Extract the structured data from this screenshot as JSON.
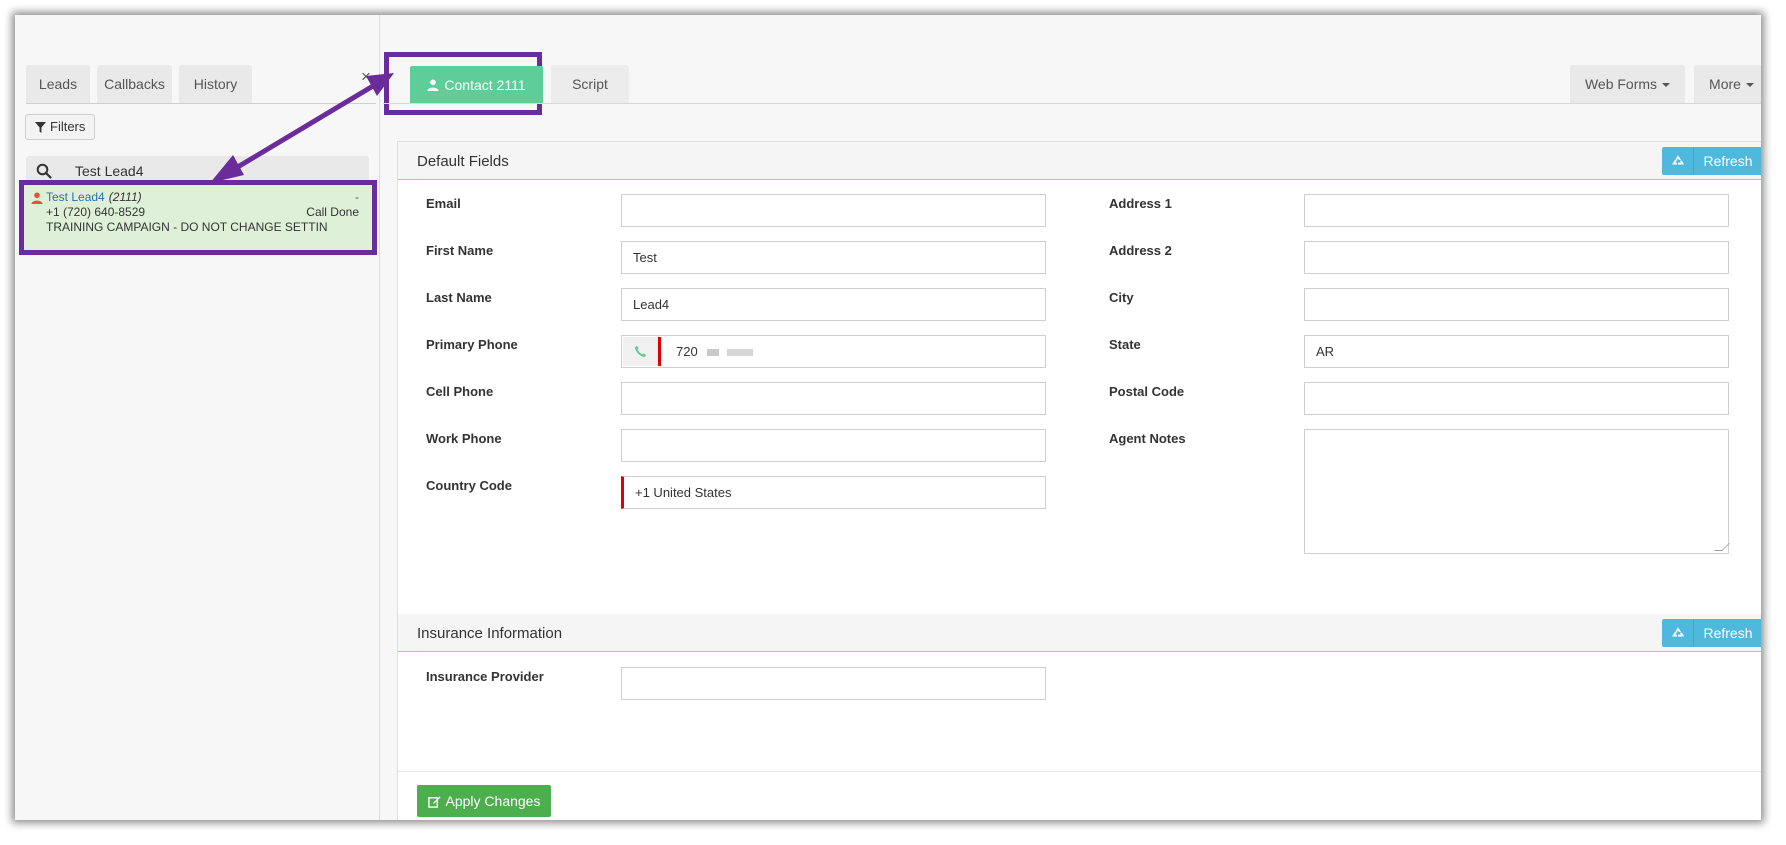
{
  "left_tabs": {
    "leads": "Leads",
    "callbacks": "Callbacks",
    "history": "History"
  },
  "filters": {
    "label": "Filters"
  },
  "search": {
    "value": "Test Lead4"
  },
  "lead": {
    "name": "Test Lead4",
    "id": "(2111)",
    "dash": "-",
    "phone": "+1 (720) 640-8529",
    "status": "Call Done",
    "campaign": "TRAINING CAMPAIGN - DO NOT CHANGE SETTIN"
  },
  "tabs": {
    "contact": "Contact 2111",
    "script": "Script",
    "web_forms": "Web Forms",
    "more": "More",
    "close": "×"
  },
  "default_fields": {
    "title": "Default Fields",
    "refresh": "Refresh",
    "left": [
      {
        "label": "Email",
        "value": ""
      },
      {
        "label": "First Name",
        "value": "Test"
      },
      {
        "label": "Last Name",
        "value": "Lead4"
      },
      {
        "label": "Primary Phone",
        "value": "720"
      },
      {
        "label": "Cell Phone",
        "value": ""
      },
      {
        "label": "Work Phone",
        "value": ""
      },
      {
        "label": "Country Code",
        "value": "+1 United States"
      }
    ],
    "right": [
      {
        "label": "Address 1",
        "value": ""
      },
      {
        "label": "Address 2",
        "value": ""
      },
      {
        "label": "City",
        "value": ""
      },
      {
        "label": "State",
        "value": "AR"
      },
      {
        "label": "Postal Code",
        "value": ""
      },
      {
        "label": "Agent Notes",
        "value": ""
      }
    ]
  },
  "insurance": {
    "title": "Insurance Information",
    "refresh": "Refresh",
    "provider_label": "Insurance Provider",
    "provider_value": ""
  },
  "apply": {
    "label": "Apply Changes"
  },
  "colors": {
    "annotation_purple": "#6a2c9a",
    "contact_tab_green": "#5ecd97",
    "lead_card_bg": "#dff0d8",
    "refresh_blue": "#4fb8dd",
    "apply_green": "#4cae4c",
    "required_red": "#e00000"
  },
  "icons": {
    "filter": "filter-icon",
    "search": "search-icon",
    "person": "person-icon",
    "refresh": "recycle-icon",
    "phone": "phone-icon",
    "edit": "edit-icon"
  }
}
